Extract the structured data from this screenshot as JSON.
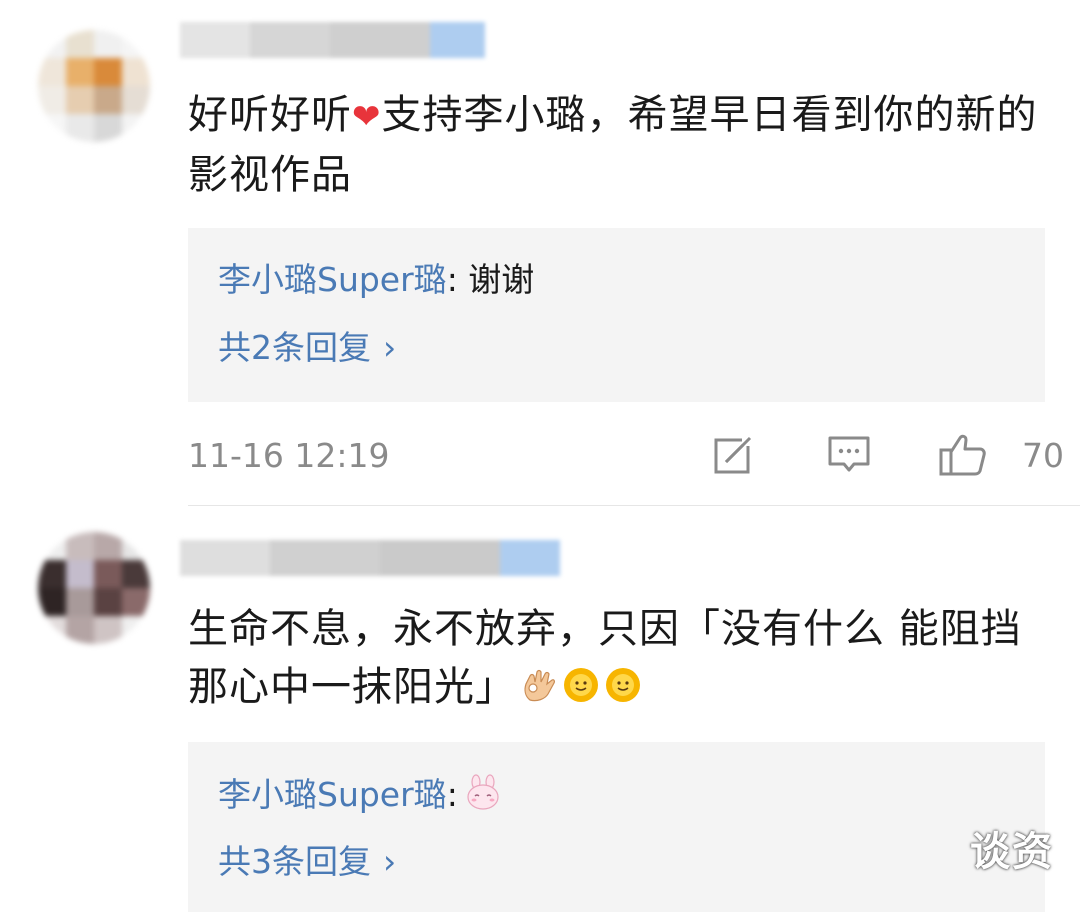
{
  "comments": [
    {
      "text_part1": "好听好听",
      "heart": "❤",
      "text_part2": "支持李小璐，希望早日看到你的新的影视作品",
      "reply": {
        "author": "李小璐Super璐",
        "separator": ": ",
        "text": "谢谢"
      },
      "more_replies": "共2条回复",
      "chevron": "›",
      "timestamp": "11-16 12:19",
      "like_count": "70"
    },
    {
      "text": "生命不息，永不放弃，只因「没有什么 能阻挡那心中一抹阳光」",
      "emojis": [
        "ok-hand-emoji",
        "sunflower-emoji",
        "sunflower-emoji"
      ],
      "reply": {
        "author": "李小璐Super璐",
        "separator": ":",
        "emoji": "bunny-emoji"
      },
      "more_replies": "共3条回复",
      "chevron": "›"
    }
  ],
  "icons": {
    "repost": "repost-icon",
    "reply": "comment-icon",
    "like": "thumbs-up-icon"
  },
  "colors": {
    "link": "#4a7ab5",
    "meta": "#8a8a8a",
    "reply_bg": "#f4f4f4",
    "heart": "#e8343b"
  },
  "watermark": "谈资"
}
